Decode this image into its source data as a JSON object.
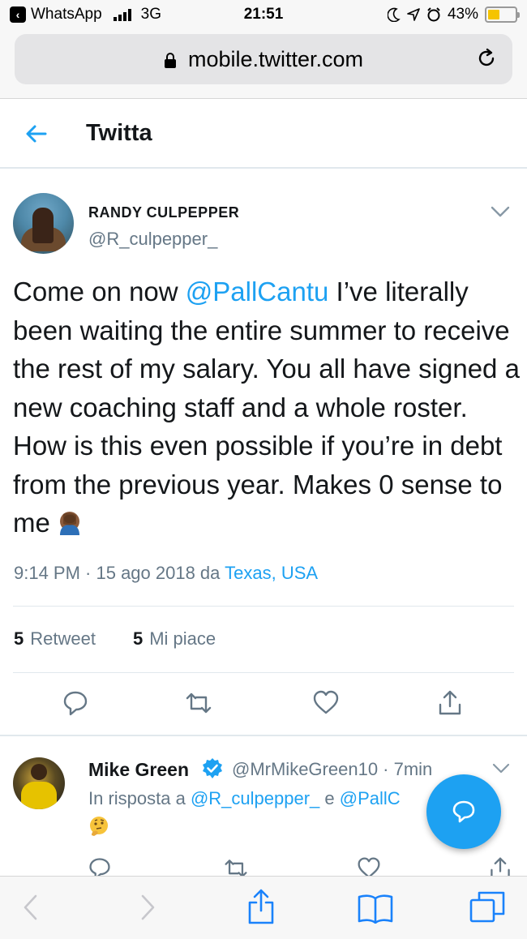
{
  "status_bar": {
    "back_app": "WhatsApp",
    "network": "3G",
    "time": "21:51",
    "battery": "43%",
    "battery_level": 0.43
  },
  "browser": {
    "url": "mobile.twitter.com"
  },
  "header": {
    "title": "Twitta"
  },
  "tweet": {
    "author_name": "RANDY CULPEPPER",
    "author_handle": "@R_culpepper_",
    "text_before": "Come on now ",
    "mention": "@PallCantu",
    "text_after": " I’ve literally been waiting the entire summer to receive the rest of my salary. You all have signed a new coaching staff and a whole roster. How is this even possible if you’re in debt from the previous year. Makes 0  sense to me",
    "emoji": "facepalm",
    "timestamp": "9:14 PM · 15 ago 2018 da ",
    "location": "Texas, USA",
    "retweet_count": "5",
    "retweet_label": "Retweet",
    "like_count": "5",
    "like_label": "Mi piace"
  },
  "reply": {
    "author_name": "Mike Green",
    "verified": true,
    "handle_time": "@MrMikeGreen10 · 7min",
    "context_prefix": "In risposta a ",
    "context_mention1": "@R_culpepper_",
    "context_join": " e ",
    "context_mention2": "@PallC",
    "emoji": "thinking"
  },
  "icons": {
    "accent": "#1da1f2",
    "text_secondary": "#657786",
    "text_primary": "#14171a"
  }
}
